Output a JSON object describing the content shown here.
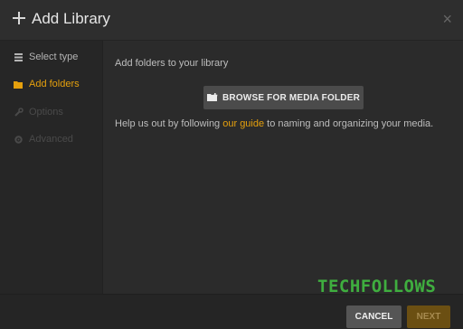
{
  "dialog": {
    "title": "Add Library",
    "close_label": "×"
  },
  "sidebar": {
    "items": [
      {
        "label": "Select type",
        "icon": "list-icon",
        "state": "normal"
      },
      {
        "label": "Add folders",
        "icon": "folder-icon",
        "state": "active"
      },
      {
        "label": "Options",
        "icon": "wrench-icon",
        "state": "disabled"
      },
      {
        "label": "Advanced",
        "icon": "gear-icon",
        "state": "disabled"
      }
    ]
  },
  "content": {
    "intro": "Add folders to your library",
    "browse_button": "BROWSE FOR MEDIA FOLDER",
    "help_prefix": "Help us out by following ",
    "help_link": "our guide",
    "help_suffix": " to naming and organizing your media."
  },
  "footer": {
    "cancel_label": "CANCEL",
    "next_label": "NEXT"
  },
  "watermark": "TECHFOLLOWS",
  "colors": {
    "accent": "#e5a00d",
    "background": "#2b2b2b",
    "sidebar": "#262626",
    "watermark": "#3fae3f"
  }
}
